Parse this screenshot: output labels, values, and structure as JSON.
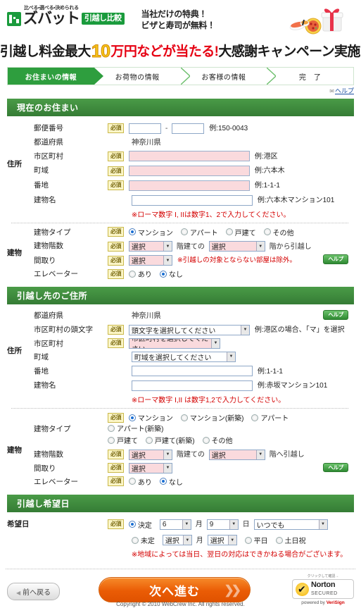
{
  "header": {
    "logo_tagline": "比べる・選べる・決められる",
    "logo_word": "ズバット",
    "logo_badge": "引越し比較",
    "promo_line1": "当社だけの特典！",
    "promo_line2": "ビザと寿司が無料！",
    "gift_icon": "gift-sushi-pizza-icon"
  },
  "campaign": {
    "part1": "引越し料金最大",
    "number": "10",
    "part2": "万円などが当たる!",
    "part3": "大感謝キャンペーン実施中!"
  },
  "steps": [
    {
      "label": "お住まいの情報",
      "active": true
    },
    {
      "label": "お荷物の情報",
      "active": false
    },
    {
      "label": "お客様の情報",
      "active": false
    },
    {
      "label": "完　了",
      "active": false
    }
  ],
  "help_link": {
    "label": "ヘルプ",
    "icon": "mail-icon"
  },
  "labels": {
    "required": "必須",
    "help": "ヘルプ",
    "group_address": "住所",
    "group_building": "建物",
    "postal_code": "郵便番号",
    "prefecture": "都道府県",
    "city": "市区町村",
    "town": "町域",
    "block": "番地",
    "building_name": "建物名",
    "building_type": "建物タイプ",
    "building_floors": "建物階数",
    "layout": "間取り",
    "elevator": "エレベーター",
    "city_initial": "市区町村の頭文字",
    "desired_date": "希望日"
  },
  "current_home": {
    "section_title": "現在のお住まい",
    "postal_example": "例:150-0043",
    "postal_value1": "",
    "postal_value2": "",
    "prefecture_value": "神奈川県",
    "city_value": "",
    "city_example": "例:港区",
    "town_value": "",
    "town_example": "例:六本木",
    "block_value": "",
    "block_example": "例:1-1-1",
    "building_name_value": "",
    "building_name_example": "例:六本木マンション101",
    "roman_note": "※ローマ数字 I, IIは数字1、2で入力してください。",
    "building_types": [
      {
        "label": "マンション",
        "selected": true
      },
      {
        "label": "アパート",
        "selected": false
      },
      {
        "label": "戸建て",
        "selected": false
      },
      {
        "label": "その他",
        "selected": false
      }
    ],
    "floors_select1": "選択",
    "floors_mid_text": "階建ての",
    "floors_select2": "選択",
    "floors_end_text": "階から引越し",
    "layout_select": "選択",
    "layout_note": "※引越しの対象とならない部屋は除外。",
    "elevator_options": [
      {
        "label": "あり",
        "selected": false
      },
      {
        "label": "なし",
        "selected": true
      }
    ]
  },
  "destination": {
    "section_title": "引越し先のご住所",
    "prefecture_value": "神奈川県",
    "city_initial_select": "頭文字を選択してください",
    "city_initial_example": "例:港区の場合、「マ」を選択",
    "city_select": "市区町村を選択してください",
    "town_select": "町域を選択してください",
    "block_value": "",
    "block_example": "例:1-1-1",
    "building_name_value": "",
    "building_name_example": "例:赤坂マンション101",
    "roman_note": "※ローマ数字 I,II は数字1,2で入力してください。",
    "building_types_row1": [
      {
        "label": "マンション",
        "selected": true
      },
      {
        "label": "マンション(新築)",
        "selected": false
      },
      {
        "label": "アパート",
        "selected": false
      },
      {
        "label": "アパート(新築)",
        "selected": false
      }
    ],
    "building_types_row2": [
      {
        "label": "戸建て",
        "selected": false
      },
      {
        "label": "戸建て(新築)",
        "selected": false
      },
      {
        "label": "その他",
        "selected": false
      }
    ],
    "floors_select1": "選択",
    "floors_mid_text": "階建ての",
    "floors_select2": "選択",
    "floors_end_text": "階へ引越し",
    "layout_select": "選択",
    "elevator_options": [
      {
        "label": "あり",
        "selected": false
      },
      {
        "label": "なし",
        "selected": true
      }
    ]
  },
  "moving_date": {
    "section_title": "引越し希望日",
    "decided": {
      "label": "決定",
      "selected": true
    },
    "month_value": "6",
    "month_unit": "月",
    "day_value": "9",
    "day_unit": "日",
    "time_value": "いつでも",
    "undecided": {
      "label": "未定",
      "selected": false
    },
    "undecided_month": "選択",
    "undecided_day": "選択",
    "weekday": {
      "label": "平日",
      "selected": false
    },
    "weekend": {
      "label": "土日祝",
      "selected": false
    },
    "note": "※地域によっては当日、翌日の対応はできかねる場合がございます。"
  },
  "footer": {
    "back_label": "前へ戻る",
    "next_label": "次へ進む",
    "norton_click": "クリックして確認→",
    "norton_name": "Norton",
    "norton_secured": "SECURED",
    "norton_powered_pre": "powered by ",
    "norton_powered_brand": "VeriSign",
    "copyright": "Copyright © 2010 WebCrew Inc. All rights reserved."
  }
}
